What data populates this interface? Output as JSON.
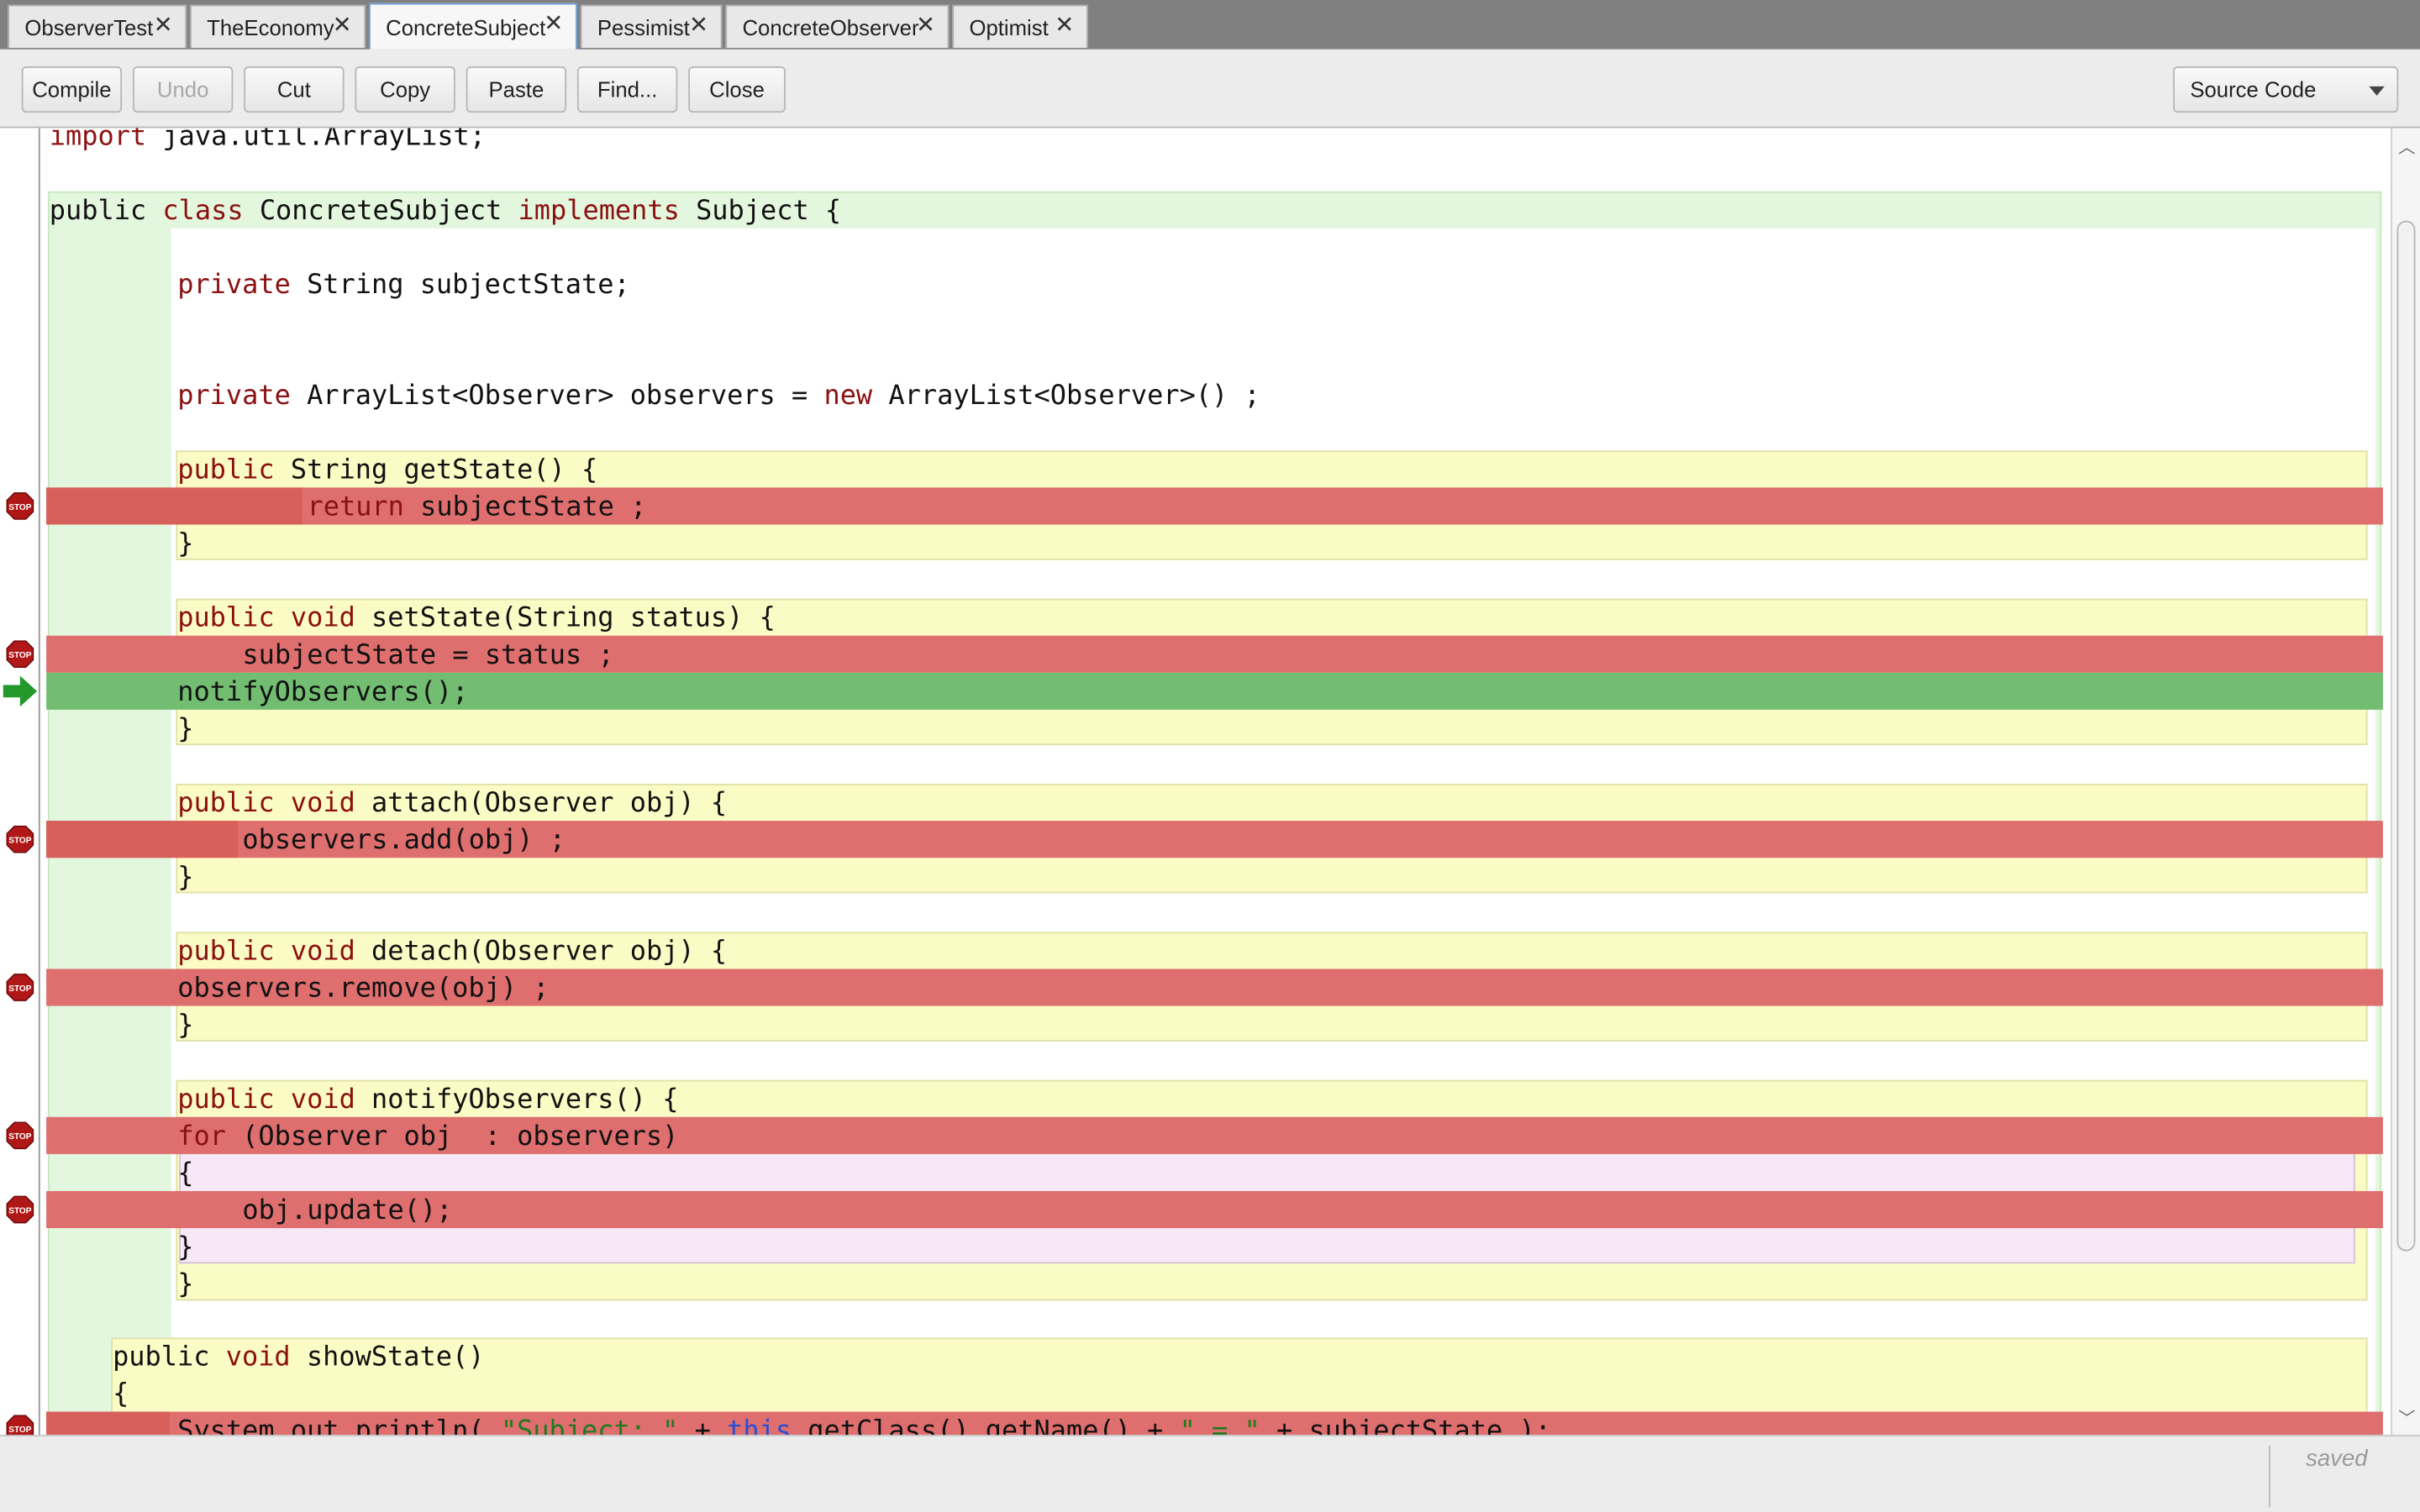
{
  "tabs": [
    {
      "label": "ObserverTest",
      "active": false
    },
    {
      "label": "TheEconomy",
      "active": false
    },
    {
      "label": "ConcreteSubject",
      "active": true
    },
    {
      "label": "Pessimist",
      "active": false
    },
    {
      "label": "ConcreteObserver",
      "active": false
    },
    {
      "label": "Optimist",
      "active": false
    }
  ],
  "tab_close_glyph": "✕",
  "toolbar": {
    "compile": "Compile",
    "undo": "Undo",
    "cut": "Cut",
    "copy": "Copy",
    "paste": "Paste",
    "find": "Find...",
    "close": "Close",
    "view_select": "Source Code"
  },
  "code": {
    "import_kw": "import",
    "import_rest": " java.util.ArrayList;",
    "class_decl": {
      "k1": "public",
      "k2": "class",
      "name": " ConcreteSubject ",
      "k3": "implements",
      "rest": " Subject {"
    },
    "field1": {
      "k": "private",
      "rest": " String subjectState;"
    },
    "field2": {
      "k": "private",
      "mid": " ArrayList<Observer> observers = ",
      "k2": "new",
      "rest": " ArrayList<Observer>() ;"
    },
    "getState_sig": {
      "k": "public",
      "rest": " String getState() {"
    },
    "getState_body": {
      "k": "return",
      "rest": " subjectState ;"
    },
    "close_brace": "}",
    "open_brace": "{",
    "setState_sig": {
      "k1": "public",
      "k2": "void",
      "rest": " setState(String status) {"
    },
    "setState_body1": "subjectState = status ;",
    "setState_body2": "notifyObservers();",
    "attach_sig": {
      "k1": "public",
      "k2": "void",
      "rest": " attach(Observer obj) {"
    },
    "attach_body": "observers.add(obj) ;",
    "detach_sig": {
      "k1": "public",
      "k2": "void",
      "rest": " detach(Observer obj) {"
    },
    "detach_body": "observers.remove(obj) ;",
    "notify_sig": {
      "k1": "public",
      "k2": "void",
      "rest": " notifyObservers() {"
    },
    "for_line": {
      "k": "for",
      "rest": " (Observer obj  : observers)"
    },
    "update_line": "obj.update();",
    "show_sig": {
      "k1": "public",
      "k2": "void",
      "rest": " showState()"
    },
    "println": {
      "a": "System.out.println( ",
      "s1": "\"Subject: \"",
      "b": " + ",
      "this": "this",
      "c": ".getClass().getName() + ",
      "s2": "\" = \"",
      "d": " + subjectState );"
    }
  },
  "colors": {
    "breakpoint_line": "#df6e6e",
    "execution_line": "#72bd72",
    "class_scope": "#e3f7df",
    "method_scope": "#fbfbc5",
    "loop_scope": "#f7e8f7",
    "keyword": "#8b1010"
  },
  "icons": {
    "breakpoint": "stop-sign-icon",
    "execution": "green-arrow-icon"
  },
  "stop_label": "STOP",
  "status": "saved"
}
